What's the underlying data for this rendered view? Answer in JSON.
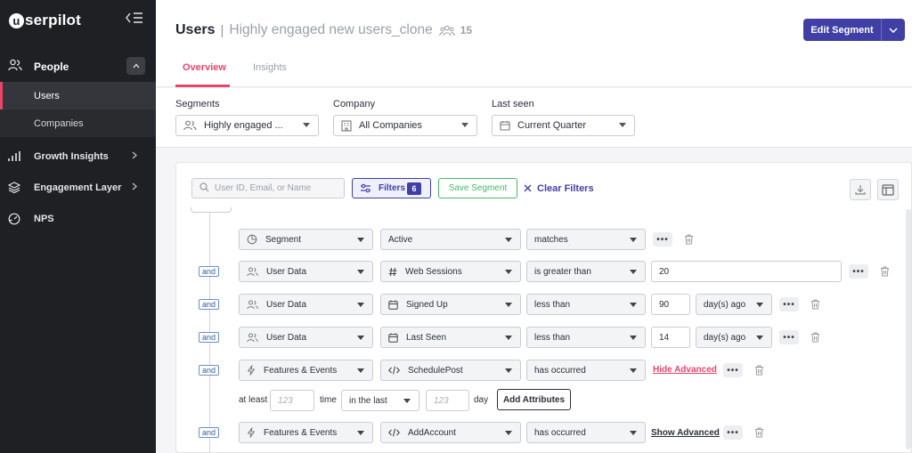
{
  "sidebar": {
    "brand_letter": "u",
    "brand_rest": "serpilot",
    "collapse_glyph": "<☰",
    "people_label": "People",
    "items": [
      {
        "label": "Users"
      },
      {
        "label": "Companies"
      }
    ],
    "nav": [
      {
        "label": "Growth Insights",
        "icon": "bar-chart-icon"
      },
      {
        "label": "Engagement Layer",
        "icon": "layers-icon"
      },
      {
        "label": "NPS",
        "icon": "gauge-icon"
      }
    ]
  },
  "header": {
    "title": "Users",
    "separator": "|",
    "segment_name": "Highly engaged new users_clone",
    "user_count": "15",
    "edit_button": "Edit Segment",
    "tabs": [
      {
        "label": "Overview"
      },
      {
        "label": "Insights"
      }
    ]
  },
  "top_filters": {
    "segments": {
      "label": "Segments",
      "value": "Highly engaged ..."
    },
    "company": {
      "label": "Company",
      "value": "All Companies"
    },
    "last_seen": {
      "label": "Last seen",
      "value": "Current Quarter"
    }
  },
  "toolbar": {
    "search_placeholder": "User ID, Email, or Name",
    "filters_label": "Filters",
    "filters_count": "6",
    "save_segment": "Save Segment",
    "clear_filters": "Clear Filters"
  },
  "conditions": {
    "and_label": "and",
    "dots": "•••",
    "row1": {
      "type": "Segment",
      "field": "Active",
      "operator": "matches"
    },
    "row2": {
      "type": "User Data",
      "field": "Web Sessions",
      "operator": "is greater than",
      "value": "20"
    },
    "row3": {
      "type": "User Data",
      "field": "Signed Up",
      "operator": "less than",
      "value": "90",
      "unit": "day(s) ago"
    },
    "row4": {
      "type": "User Data",
      "field": "Last Seen",
      "operator": "less than",
      "value": "14",
      "unit": "day(s) ago"
    },
    "row5": {
      "type": "Features & Events",
      "field": "SchedulePost",
      "operator": "has occurred",
      "link": "Hide Advanced"
    },
    "advanced": {
      "at_least": "at least",
      "placeholder1": "123",
      "time": "time",
      "range": "in the last",
      "placeholder2": "123",
      "day": "day",
      "add_attributes": "Add Attributes"
    },
    "row6": {
      "type": "Features & Events",
      "field": "AddAccount",
      "operator": "has occurred",
      "link": "Show Advanced"
    }
  },
  "colors": {
    "accent": "#3f3fa6",
    "brand_pink": "#e8456b",
    "success": "#48b86a",
    "sidebar_bg": "#1f2023"
  }
}
